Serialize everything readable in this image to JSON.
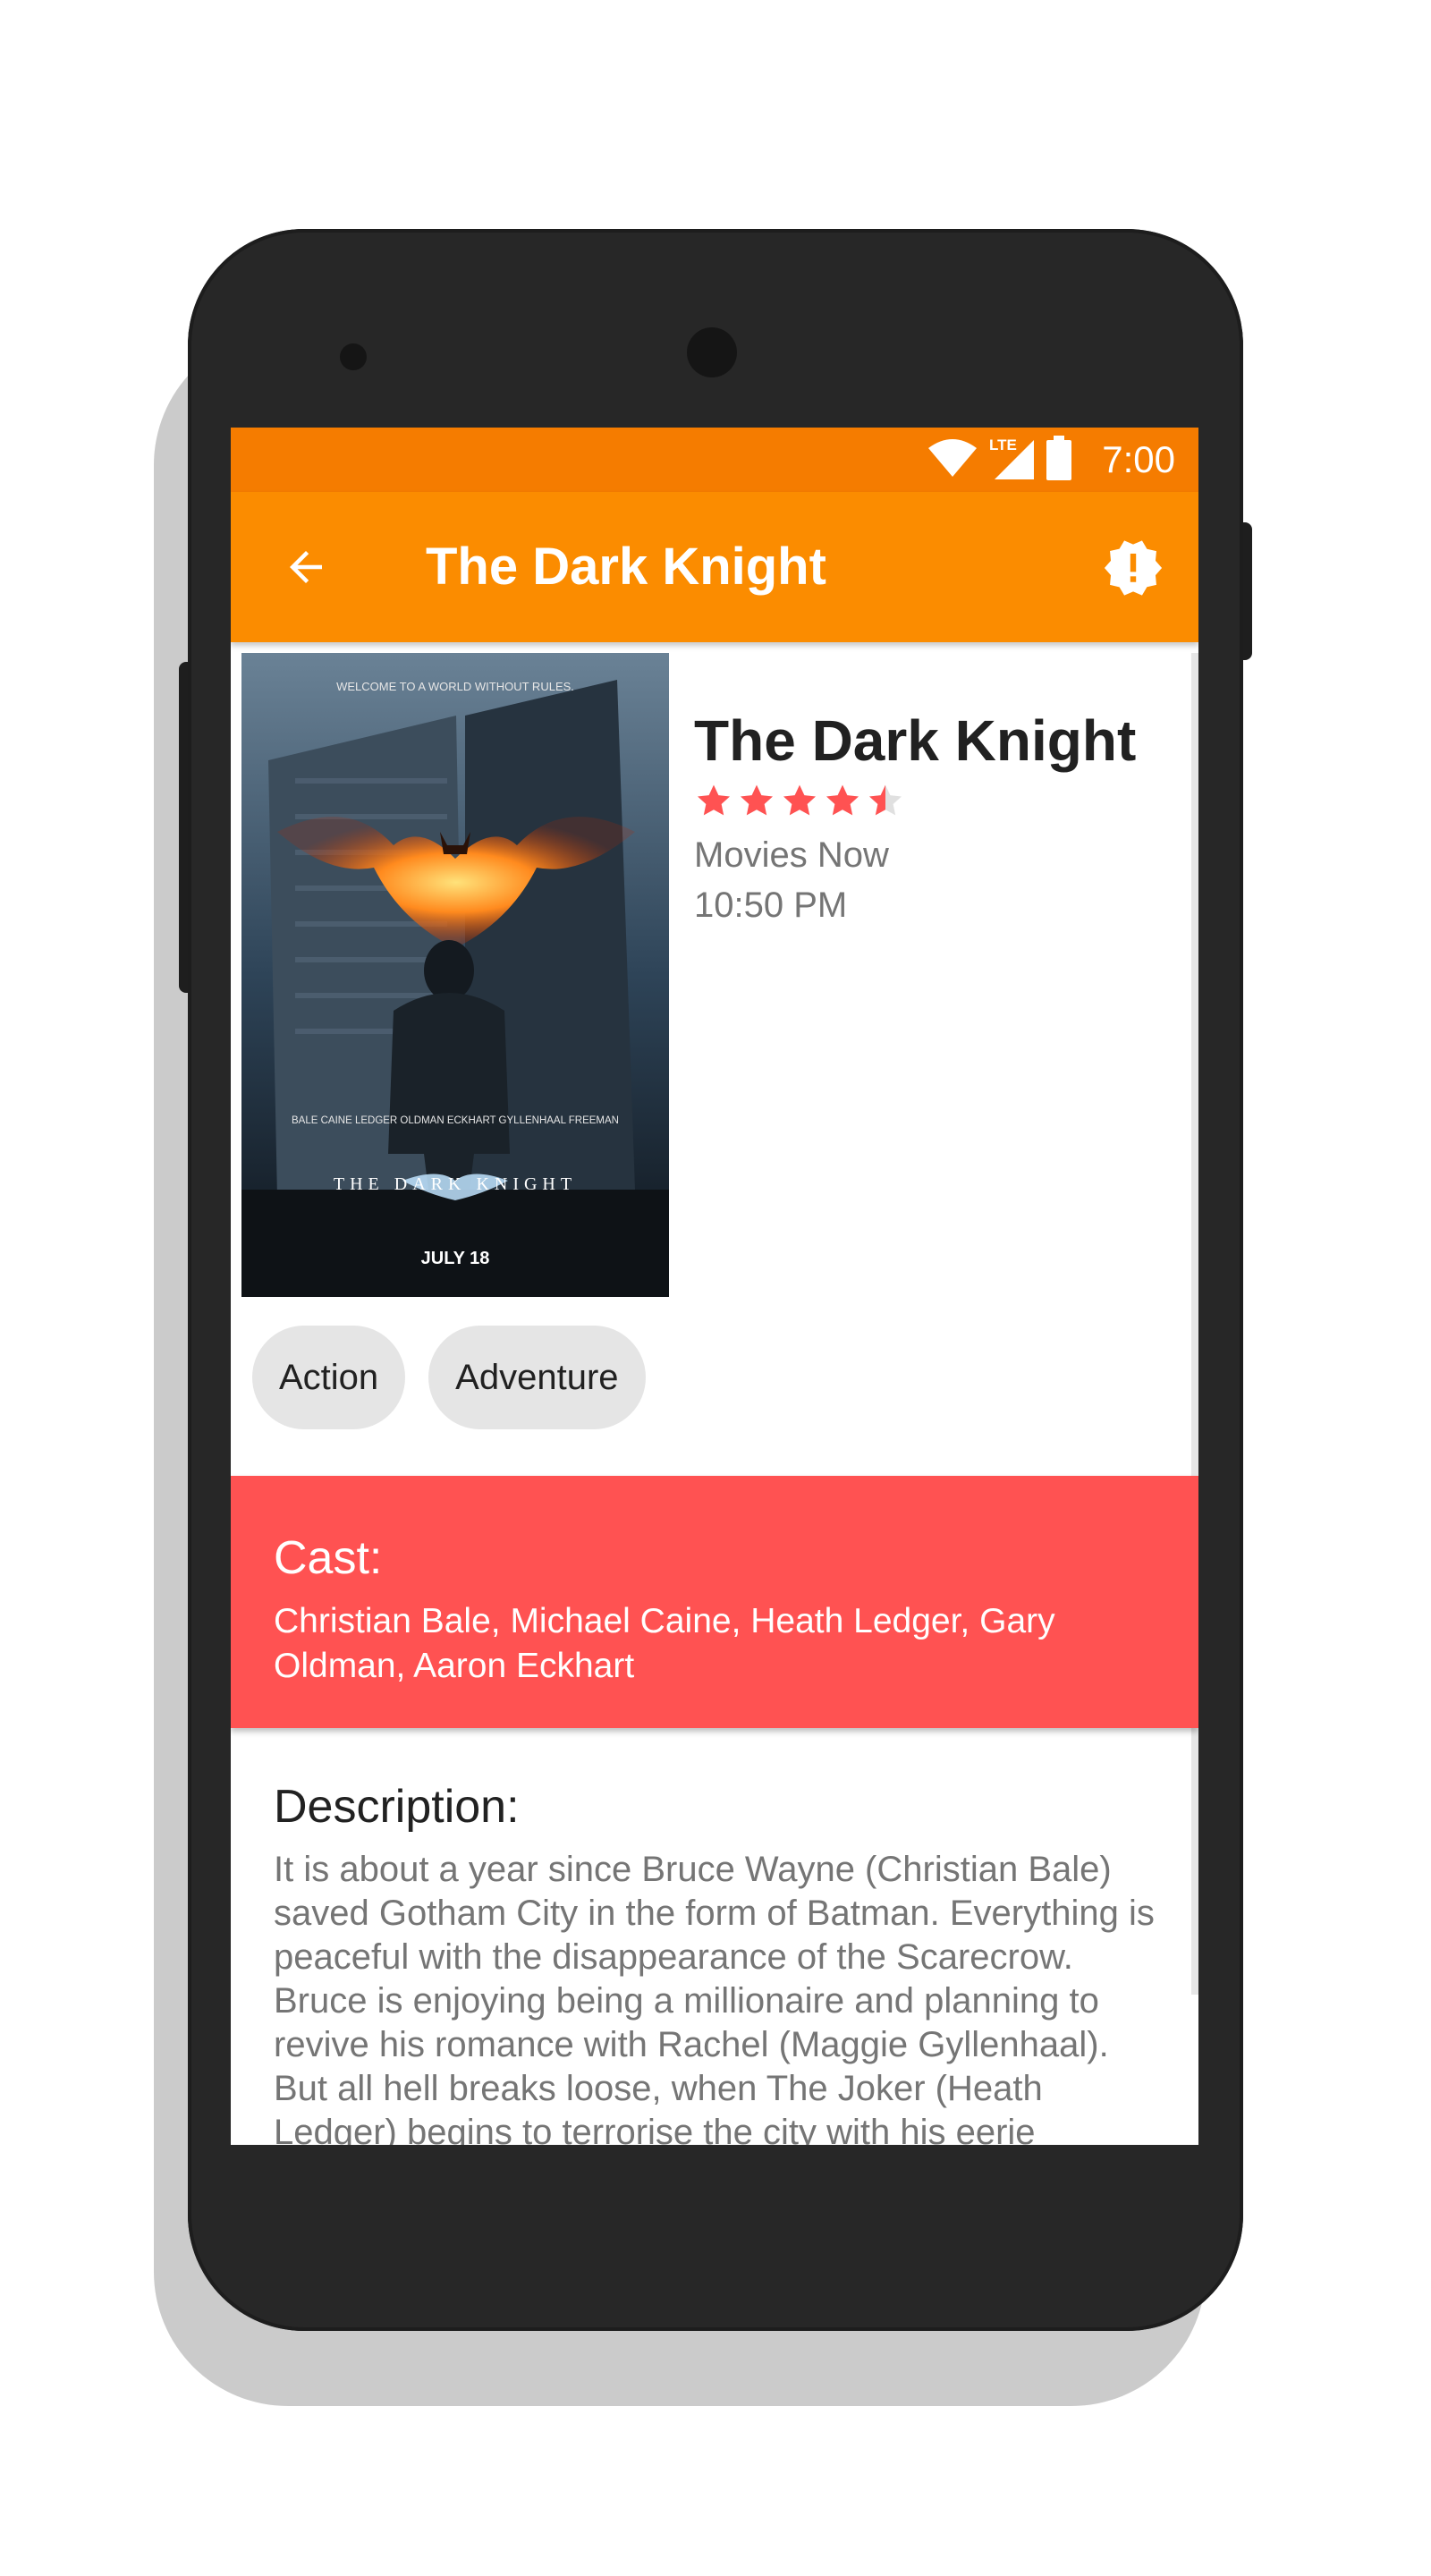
{
  "status_bar": {
    "time": "7:00",
    "network_label": "LTE"
  },
  "app_bar": {
    "title": "The Dark Knight"
  },
  "movie": {
    "title": "The Dark Knight",
    "rating": 4.5,
    "rating_max": 5,
    "channel": "Movies Now",
    "time": "10:50 PM",
    "genres": [
      "Action",
      "Adventure"
    ]
  },
  "poster": {
    "tagline": "WELCOME TO A WORLD WITHOUT RULES.",
    "billing_names": "BALE  CAINE  LEDGER  OLDMAN  ECKHART  GYLLENHAAL  FREEMAN",
    "title": "THE DARK KNIGHT",
    "release_date": "JULY 18"
  },
  "cast": {
    "heading": "Cast:",
    "names": "Christian Bale, Michael Caine, Heath Ledger, Gary Oldman, Aaron Eckhart"
  },
  "description": {
    "heading": "Description:",
    "text": "It is about a year since Bruce Wayne (Christian Bale) saved Gotham City in the form of Batman. Everything is peaceful with the disappearance of the Scarecrow. Bruce is enjoying being a millionaire and planning to revive his romance with Rachel (Maggie Gyllenhaal). But all hell breaks loose, when The Joker (Heath Ledger) begins to terrorise the city with his eerie"
  },
  "colors": {
    "status_bar": "#f57c00",
    "app_bar": "#fb8c00",
    "cast_panel": "#ff5252",
    "star": "#ff5252",
    "chip": "#e5e5e5"
  },
  "icons": {
    "back": "arrow-left-icon",
    "alert": "alert-badge-icon",
    "wifi": "wifi-icon",
    "signal": "signal-icon",
    "battery": "battery-icon",
    "star": "star-icon"
  }
}
